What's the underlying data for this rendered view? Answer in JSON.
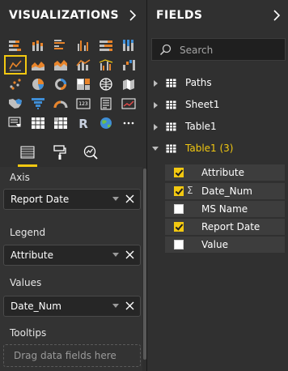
{
  "colors": {
    "accent": "#f2c811",
    "pane_bg": "#2f2f2f",
    "well_bg": "#262626"
  },
  "visualizations": {
    "title": "VISUALIZATIONS",
    "gallery_icons": [
      [
        "stacked-bar-icon",
        "stacked-column-icon",
        "clustered-bar-icon",
        "clustered-column-icon",
        "100-stacked-bar-icon",
        "100-stacked-column-icon"
      ],
      [
        "line-chart-icon",
        "area-chart-icon",
        "stacked-area-icon",
        "line-stacked-column-icon",
        "line-clustered-column-icon",
        "waterfall-icon"
      ],
      [
        "scatter-icon",
        "pie-icon",
        "donut-icon",
        "treemap-icon",
        "map-icon",
        "filled-map-icon"
      ],
      [
        "shape-map-icon",
        "funnel-icon",
        "gauge-icon",
        "card-icon",
        "multirow-card-icon",
        "kpi-icon"
      ],
      [
        "slicer-icon",
        "table-icon",
        "matrix-icon",
        "r-visual-icon",
        "globe-icon",
        "more-icon"
      ]
    ],
    "selected_visual": "line-chart-icon",
    "tabs": [
      "fields-tab-icon",
      "format-roller-icon",
      "analytics-icon"
    ],
    "wells": {
      "axis": {
        "label": "Axis",
        "value": "Report Date"
      },
      "legend": {
        "label": "Legend",
        "value": "Attribute"
      },
      "values": {
        "label": "Values",
        "value": "Date_Num"
      },
      "tooltips": {
        "label": "Tooltips",
        "placeholder": "Drag data fields here"
      }
    }
  },
  "fields": {
    "title": "FIELDS",
    "search_placeholder": "Search",
    "tables": [
      {
        "name": "Paths",
        "expanded": false
      },
      {
        "name": "Sheet1",
        "expanded": false
      },
      {
        "name": "Table1",
        "expanded": false
      },
      {
        "name": "Table1 (3)",
        "expanded": true
      }
    ],
    "table1_3_fields": [
      {
        "name": "Attribute",
        "checked": true,
        "sigma": false
      },
      {
        "name": "Date_Num",
        "checked": true,
        "sigma": true
      },
      {
        "name": "MS Name",
        "checked": false,
        "sigma": false
      },
      {
        "name": "Report Date",
        "checked": true,
        "sigma": false
      },
      {
        "name": "Value",
        "checked": false,
        "sigma": false
      }
    ],
    "sigma_symbol": "Σ"
  }
}
